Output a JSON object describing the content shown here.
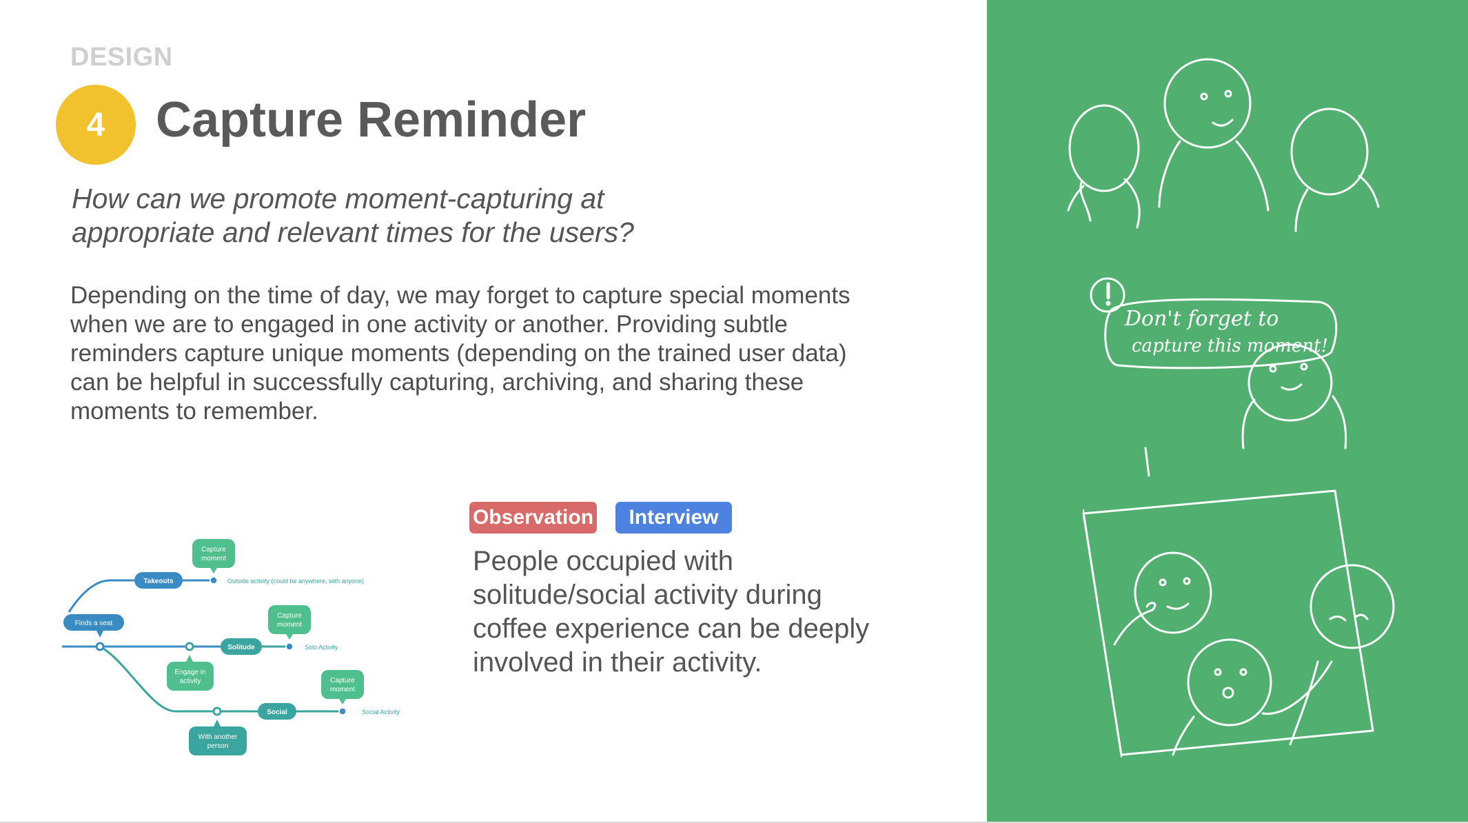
{
  "section": "DESIGN",
  "step_number": "4",
  "title": "Capture Reminder",
  "question": "How can we promote moment-capturing at appropriate and relevant times for the users?",
  "body": "Depending on the time of day, we may forget to capture special moments when we are to engaged in one activity or another. Providing subtle reminders capture unique moments (depending on the trained user data) can be helpful in successfully capturing, archiving, and sharing these moments to remember.",
  "tags": {
    "observation": "Observation",
    "interview": "Interview"
  },
  "finding": "People occupied with solitude/social activity during coffee experience can be deeply involved in their activity.",
  "flow": {
    "takeouts": "Takeouts",
    "finds_seat": "Finds a seat",
    "solitude": "Solitude",
    "social": "Social",
    "capture_1": "Capture moment",
    "capture_2": "Capture moment",
    "capture_3": "Capture moment",
    "engage": "Engage in activity",
    "with_person": "With another person",
    "outside_activity": "Outside activity (could be anywhere, with anyone)",
    "solo_activity": "Solo Activity",
    "social_activity": "Social Activity"
  },
  "sketch": {
    "speech_bubble": "Don't forget to capture this moment!"
  },
  "colors": {
    "accent_yellow": "#f2c12e",
    "observation_red": "#d96a6a",
    "interview_blue": "#4d82e0",
    "panel_green": "#51b070",
    "flow_teal": "#3aa59e",
    "flow_blue": "#3a8bc4",
    "capture_green": "#4fc08d"
  }
}
